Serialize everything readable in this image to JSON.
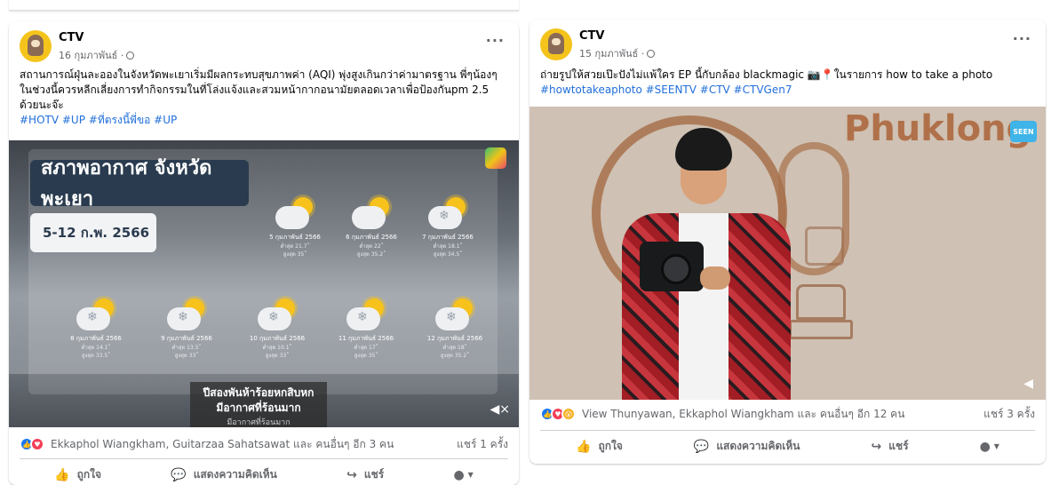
{
  "post1": {
    "page_name": "CTV",
    "date": "16 กุมภาพันธ์ ·",
    "caption": "สถานการณ์ฝุ่นละอองในจังหวัดพะเยาเริ่มมีผลกระทบสุขภาพค่า (AQI) พุ่งสูงเกินกว่าค่ามาตรฐาน พี่ๆน้องๆในช่วงนี้ควรหลีกเลี่ยงการทำกิจกรรมในที่โล่งแจ้งและสวมหน้ากากอนามัยตลอดเวลาเพื่อป้องกันpm 2.5 ด้วยนะจ๊ะ",
    "hashtags": "#HOTV #UP #ที่ตรงนี้พี่ขอ #UP",
    "video": {
      "title": "สภาพอากาศ จังหวัดพะเยา",
      "date_range": "5-12 ก.พ. 2566",
      "forecast": [
        {
          "date": "5 กุมภาพันธ์ 2566",
          "low": "ต่ำสุด 21.7˚",
          "high": "สูงสุด 35˚"
        },
        {
          "date": "6 กุมภาพันธ์ 2566",
          "low": "ต่ำสุด 22˚",
          "high": "สูงสุด 35.2˚"
        },
        {
          "date": "7 กุมภาพันธ์ 2566",
          "low": "ต่ำสุด 18.1˚",
          "high": "สูงสุด 34.5˚"
        },
        {
          "date": "8 กุมภาพันธ์ 2566",
          "low": "ต่ำสุด 14.1˚",
          "high": "สูงสุด 33.5˚"
        },
        {
          "date": "9 กุมภาพันธ์ 2566",
          "low": "ต่ำสุด 13.5˚",
          "high": "สูงสุด 33˚"
        },
        {
          "date": "10 กุมภาพันธ์ 2566",
          "low": "ต่ำสุด 10.1˚",
          "high": "สูงสุด 33˚"
        },
        {
          "date": "11 กุมภาพันธ์ 2566",
          "low": "ต่ำสุด 17˚",
          "high": "สูงสุด 35˚"
        },
        {
          "date": "12 กุมภาพันธ์ 2566",
          "low": "ต่ำสุด 18˚",
          "high": "สูงสุด 35.2˚"
        }
      ],
      "subtitle_line1": "ปีสองพันห้าร้อยหกสิบหก",
      "subtitle_line2": "มีอากาศที่ร้อนมาก",
      "subtitle_ghost": "มีอากาศที่ร้อนมาก"
    },
    "reactions_text": "Ekkaphol Wiangkham, Guitarzaa Sahatsawat และ คนอื่นๆ อีก 3 คน",
    "shares_text": "แชร์ 1 ครั้ง"
  },
  "post2": {
    "page_name": "CTV",
    "date": "15 กุมภาพันธ์ ·",
    "caption": "ถ่ายรูปให้สวยเป๊ะปังไม่แพ้ใคร EP นี้กับกล้อง blackmagic 📷📍ในรายการ how to take a photo",
    "hashtags": "#howtotakeaphoto #SEENTV #CTV #CTVGen7",
    "video": {
      "wall_text": "Phuklong",
      "badge": "SEEN"
    },
    "reactions_text": "View Thunyawan, Ekkaphol Wiangkham และ คนอื่นๆ อีก 12 คน",
    "shares_text": "แชร์ 3 ครั้ง"
  },
  "actions": {
    "like": "ถูกใจ",
    "comment": "แสดงความคิดเห็น",
    "share": "แชร์"
  },
  "icons": {
    "like": "thumbs-up-icon",
    "comment": "comment-icon",
    "share": "share-icon",
    "more": "more-icon",
    "globe": "globe-icon",
    "volume": "volume-muted-icon"
  }
}
